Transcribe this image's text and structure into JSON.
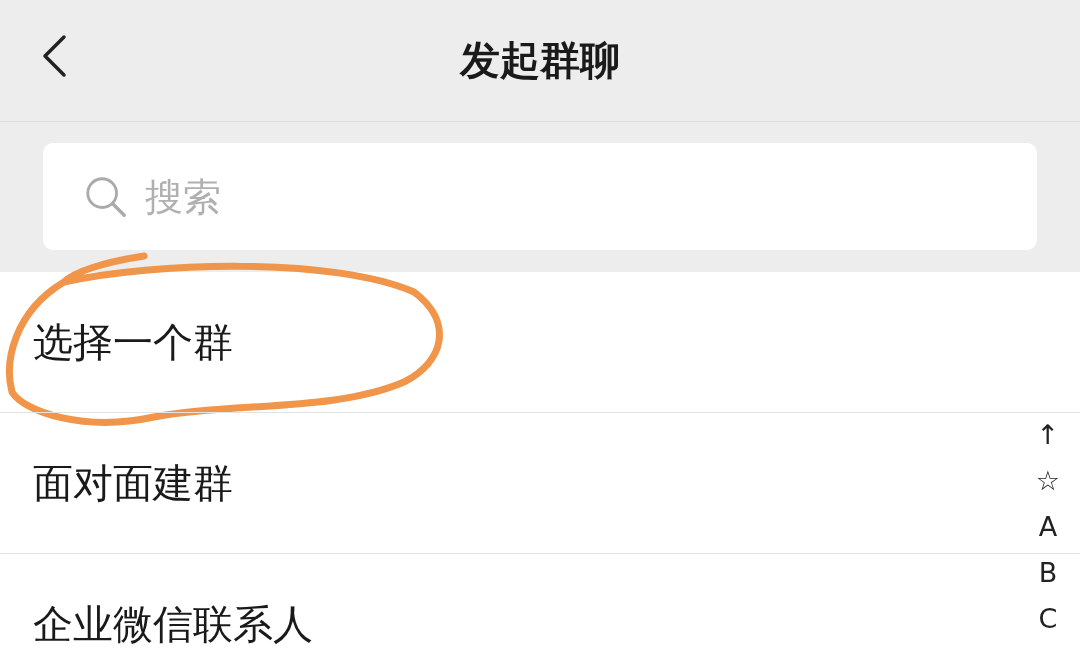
{
  "header": {
    "title": "发起群聊"
  },
  "search": {
    "placeholder": "搜索"
  },
  "items": [
    {
      "label": "选择一个群",
      "circled": true
    },
    {
      "label": "面对面建群",
      "circled": false
    },
    {
      "label": "企业微信联系人",
      "circled": false
    }
  ],
  "index_bar": [
    "↑",
    "☆",
    "A",
    "B",
    "C"
  ]
}
